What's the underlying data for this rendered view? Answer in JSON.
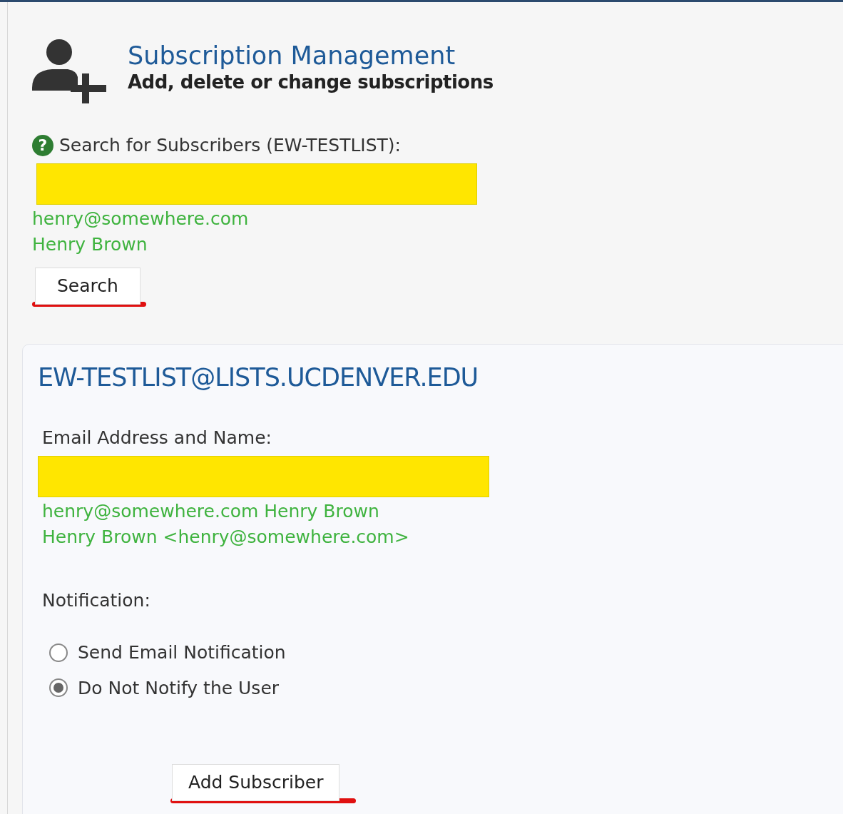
{
  "header": {
    "title": "Subscription Management",
    "subtitle": "Add, delete or change subscriptions"
  },
  "search": {
    "help": "?",
    "label": "Search for Subscribers (EW-TESTLIST):",
    "examples": [
      "henry@somewhere.com",
      "Henry Brown"
    ],
    "button": "Search"
  },
  "panel": {
    "title": "EW-TESTLIST@LISTS.UCDENVER.EDU",
    "field_label": "Email Address and Name:",
    "examples": [
      "henry@somewhere.com Henry Brown",
      "Henry Brown <henry@somewhere.com>"
    ],
    "notification_label": "Notification:",
    "options": [
      {
        "label": "Send Email Notification",
        "selected": false
      },
      {
        "label": "Do Not Notify the User",
        "selected": true
      }
    ],
    "button": "Add Subscriber"
  }
}
